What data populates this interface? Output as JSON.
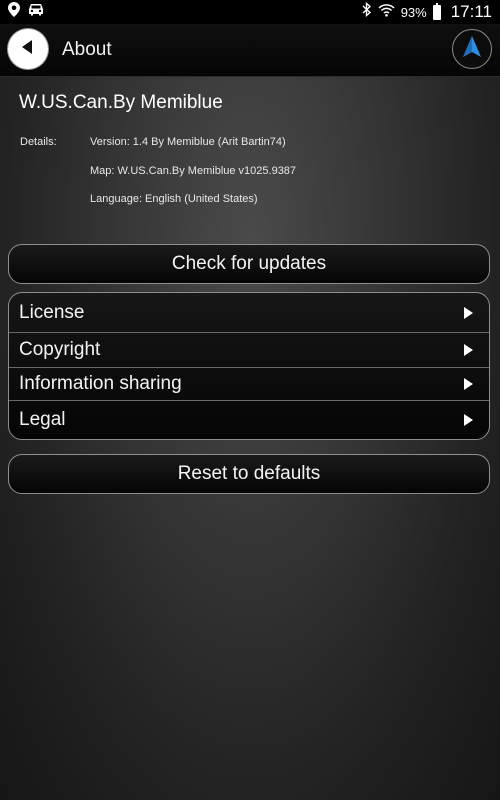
{
  "status_bar": {
    "icons_left": [
      "location-pin-icon",
      "car-icon"
    ],
    "icons_right": [
      "bluetooth-icon",
      "wifi-icon"
    ],
    "battery_percent": "93%",
    "battery_level": 0.93,
    "time": "17:11"
  },
  "header": {
    "title": "About",
    "back_icon": "back-arrow-icon",
    "nav_icon": "navigation-arrow-icon"
  },
  "app_info": {
    "name": "W.US.Can.By Memiblue",
    "details_label": "Details:",
    "version": "Version: 1.4 By Memiblue (Arit Bartin74)",
    "map": "Map: W.US.Can.By Memiblue v1025.9387",
    "language": "Language: English (United States)"
  },
  "buttons": {
    "check_updates": "Check for updates",
    "reset_defaults": "Reset to defaults"
  },
  "menu": {
    "items": [
      {
        "label": "License"
      },
      {
        "label": "Copyright"
      },
      {
        "label": "Information sharing"
      },
      {
        "label": "Legal"
      }
    ]
  },
  "colors": {
    "accent_blue": "#2e8fe0",
    "background": "#2a2a2a"
  }
}
